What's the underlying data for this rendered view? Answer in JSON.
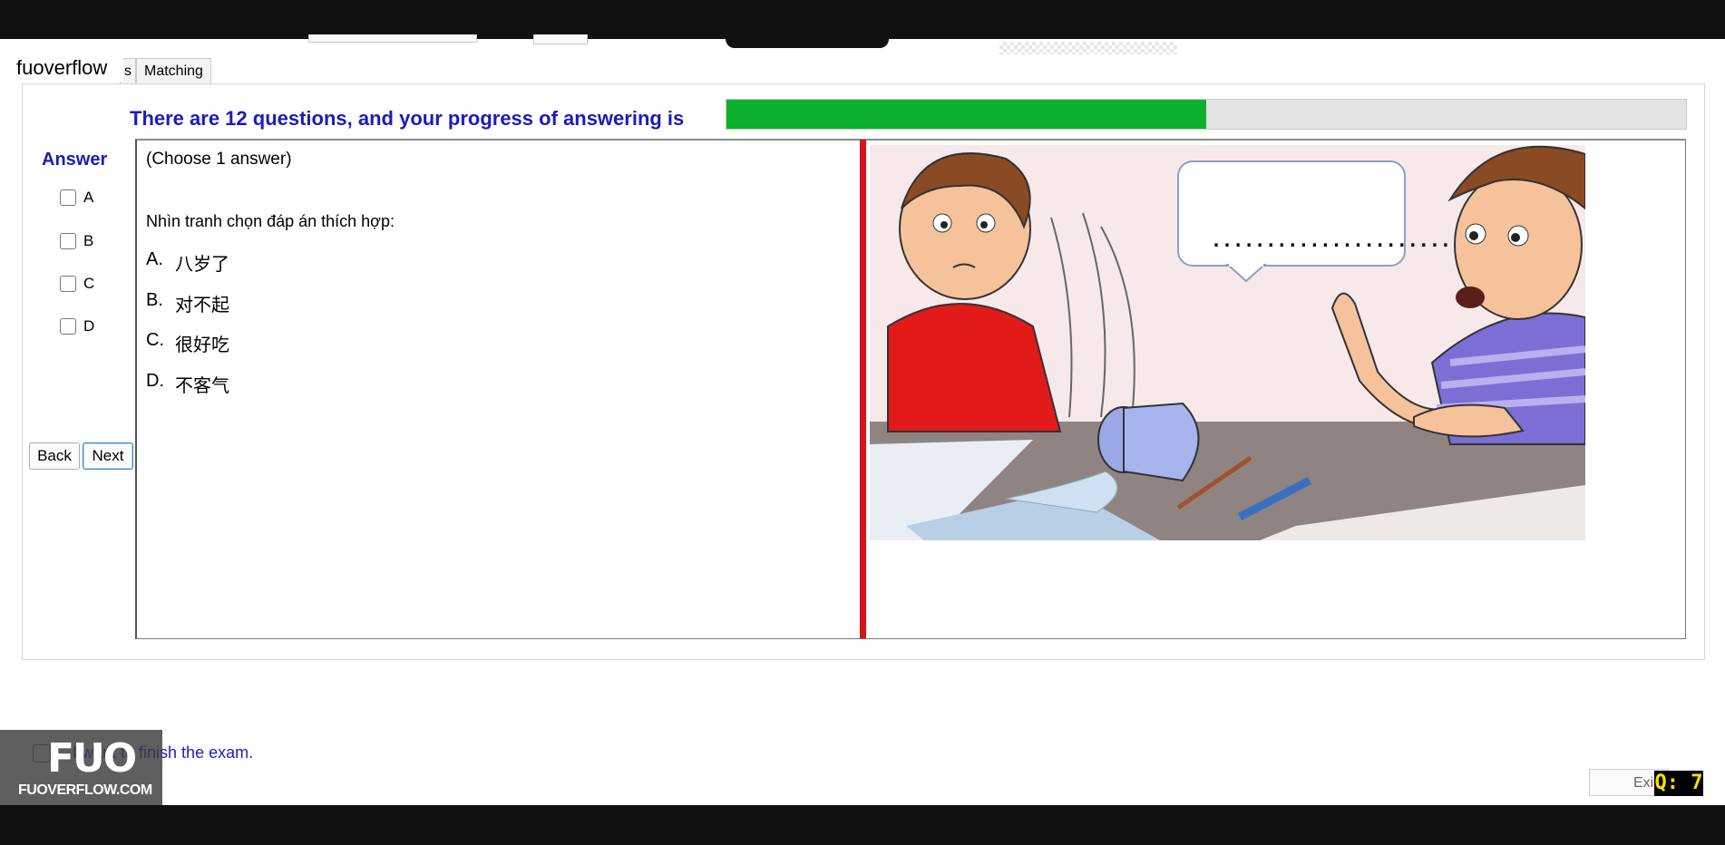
{
  "site_label": "fuoverflow",
  "tabs": [
    {
      "label": "s",
      "selected": false
    },
    {
      "label": "Matching",
      "selected": true
    }
  ],
  "progress": {
    "text": "There are 12 questions, and your progress of answering is",
    "percent": 50,
    "fill_color": "#0cb12e"
  },
  "answer_panel": {
    "title": "Answer",
    "options": [
      "A",
      "B",
      "C",
      "D"
    ]
  },
  "nav": {
    "back_label": "Back",
    "next_label": "Next"
  },
  "question": {
    "meta": "(Choose 1 answer)",
    "prompt": "Nhìn tranh chọn đáp án thích hợp:",
    "options": [
      {
        "letter": "A.",
        "text": "八岁了"
      },
      {
        "letter": "B.",
        "text": "对不起"
      },
      {
        "letter": "C.",
        "text": "很好吃"
      },
      {
        "letter": "D.",
        "text": "不客气"
      }
    ]
  },
  "illustration": {
    "speech_bubble_text": "......................"
  },
  "finish": {
    "label": "I want to finish the exam."
  },
  "watermark": {
    "big": "FUO",
    "small": "FUOVERFLOW.COM"
  },
  "exit_label": "Exit",
  "question_badge": "Q: 7",
  "colors": {
    "accent_blue": "#1b1bbd",
    "divider_red": "#d8141a",
    "badge_yellow": "#ffe000"
  }
}
